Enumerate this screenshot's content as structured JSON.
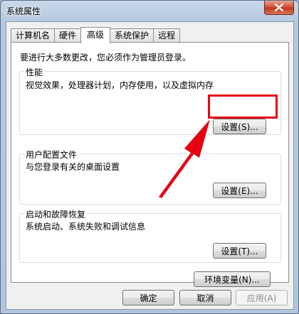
{
  "window": {
    "title": "系统属性",
    "close_icon": "close-icon"
  },
  "tabs": [
    {
      "label": "计算机名"
    },
    {
      "label": "硬件"
    },
    {
      "label": "高级",
      "active": true
    },
    {
      "label": "系统保护"
    },
    {
      "label": "远程"
    }
  ],
  "notice": "要进行大多数更改，您必须作为管理员登录。",
  "groups": {
    "performance": {
      "title": "性能",
      "desc": "视觉效果，处理器计划，内存使用，以及虚拟内存",
      "button": "设置(S)..."
    },
    "user_profiles": {
      "title": "用户配置文件",
      "desc": "与您登录有关的桌面设置",
      "button": "设置(E)..."
    },
    "startup_recovery": {
      "title": "启动和故障恢复",
      "desc": "系统启动、系统失败和调试信息",
      "button": "设置(T)..."
    }
  },
  "env_button": "环境变量(N)...",
  "footer": {
    "ok": "确定",
    "cancel": "取消",
    "apply": "应用(A)"
  },
  "annotation_color": "#e60012"
}
